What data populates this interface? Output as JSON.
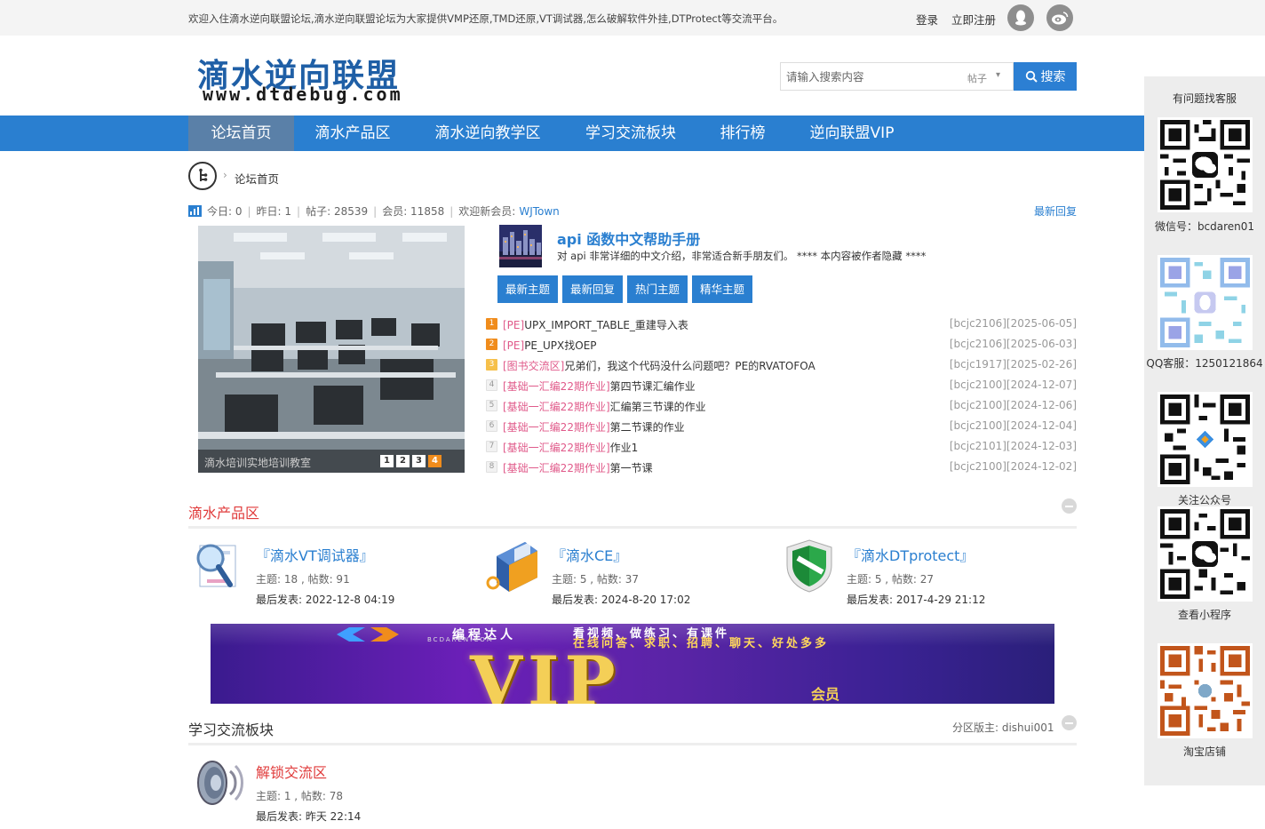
{
  "topbar": {
    "welcome": "欢迎入住滴水逆向联盟论坛,滴水逆向联盟论坛为大家提供VMP还原,TMD还原,VT调试器,怎么破解软件外挂,DTProtect等交流平台。",
    "login": "登录",
    "register": "立即注册",
    "icons": [
      "qq-icon",
      "weibo-icon"
    ]
  },
  "header": {
    "logo_title": "滴水逆向联盟",
    "logo_url": "www.dtdebug.com",
    "search_placeholder": "请输入搜索内容",
    "search_type": "帖子",
    "search_button": "搜索"
  },
  "nav": {
    "items": [
      "论坛首页",
      "滴水产品区",
      "滴水逆向教学区",
      "学习交流板块",
      "排行榜",
      "逆向联盟VIP"
    ],
    "active_index": 0
  },
  "breadcrumb": {
    "current": "论坛首页"
  },
  "stats": {
    "today": "今日: 0",
    "yesterday": "昨日: 1",
    "posts": "帖子: 28539",
    "members": "会员: 11858",
    "welcome_label": "欢迎新会员:",
    "new_member": "WJTown",
    "latest_reply_link": "最新回复"
  },
  "slideshow": {
    "caption": "滴水培训实地培训教室",
    "pages": [
      "1",
      "2",
      "3",
      "4"
    ],
    "active_page": 4
  },
  "featured": {
    "title": "api 函数中文帮助手册",
    "description": "对 api 非常详细的中文介绍，非常适合新手朋友们。 **** 本内容被作者隐藏 ****",
    "tabs": [
      "最新主题",
      "最新回复",
      "热门主题",
      "精华主题"
    ]
  },
  "threads": [
    {
      "num": "1",
      "tag": "[PE]",
      "title": "UPX_IMPORT_TABLE_重建导入表",
      "meta": "[bcjc2106][2025-06-05]"
    },
    {
      "num": "2",
      "tag": "[PE]",
      "title": "PE_UPX找OEP",
      "meta": "[bcjc2106][2025-06-03]"
    },
    {
      "num": "3",
      "tag": "[图书交流区]",
      "title": "兄弟们，我这个代码没什么问题吧？PE的RVATOFOA",
      "meta": "[bcjc1917][2025-02-26]"
    },
    {
      "num": "4",
      "tag": "[基础一汇编22期作业]",
      "title": "第四节课汇编作业",
      "meta": "[bcjc2100][2024-12-07]"
    },
    {
      "num": "5",
      "tag": "[基础一汇编22期作业]",
      "title": "汇编第三节课的作业",
      "meta": "[bcjc2100][2024-12-06]"
    },
    {
      "num": "6",
      "tag": "[基础一汇编22期作业]",
      "title": "第二节课的作业",
      "meta": "[bcjc2100][2024-12-04]"
    },
    {
      "num": "7",
      "tag": "[基础一汇编22期作业]",
      "title": "作业1",
      "meta": "[bcjc2101][2024-12-03]"
    },
    {
      "num": "8",
      "tag": "[基础一汇编22期作业]",
      "title": "第一节课",
      "meta": "[bcjc2100][2024-12-02]"
    }
  ],
  "section_products": {
    "title": "滴水产品区",
    "forums": [
      {
        "name": "『滴水VT调试器』",
        "stat": "主题: 18 , 帖数: 91",
        "last": "最后发表: 2022-12-8 04:19"
      },
      {
        "name": "『滴水CE』",
        "stat": "主题: 5 , 帖数: 37",
        "last": "最后发表: 2024-8-20 17:02"
      },
      {
        "name": "『滴水DTprotect』",
        "stat": "主题: 5 , 帖数: 27",
        "last": "最后发表: 2017-4-29 21:12"
      }
    ]
  },
  "banner": {
    "brand": "编程达人",
    "brand_sub": "BCDAREN.COM",
    "slogan1": "看视频、做练习、有课件",
    "slogan2": "在线问答、求职、招聘、聊天、好处多多",
    "vip": "VIP",
    "member": "会员"
  },
  "section_study": {
    "title": "学习交流板块",
    "moderator": "分区版主: dishui001",
    "forums": [
      {
        "name": "解锁交流区",
        "stat": "主题: 1 , 帖数: 78",
        "last": "最后发表: 昨天 22:14"
      }
    ]
  },
  "sidebar": {
    "title": "有问题找客服",
    "wechat": "微信号：bcdaren01",
    "qq": "QQ客服：1250121864",
    "official": "关注公众号",
    "mini": "查看小程序",
    "taobao": "淘宝店铺"
  },
  "colors": {
    "brand_blue": "#2a7fd0",
    "nav_active": "#5a80a8",
    "tag_pink": "#e05a8a",
    "hot_orange": "#f08c1c",
    "section_red": "#e03b3b"
  }
}
